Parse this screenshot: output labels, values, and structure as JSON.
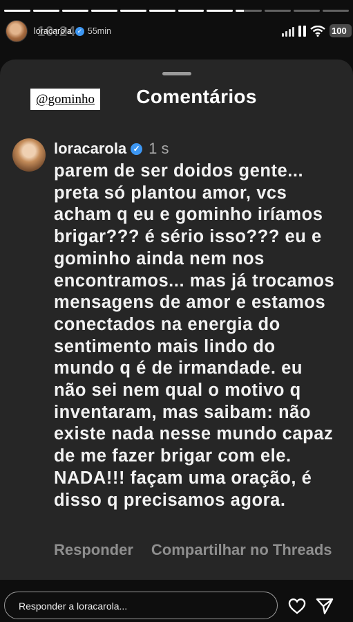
{
  "story": {
    "progress_segments": 12,
    "progress_filled": 8.3,
    "username": "loracarola",
    "time_ago": "55min",
    "status_clock": "10:24",
    "battery": "100"
  },
  "sheet": {
    "mention_tag": "@gominho",
    "title": "Comentários"
  },
  "comment": {
    "username": "loracarola",
    "time": "1 s",
    "text": "parem de ser doidos gente... preta só plantou amor, vcs acham q eu e gominho iríamos brigar??? é sério isso??? eu e gominho ainda nem nos encontramos... mas já trocamos mensagens de amor e estamos conectados na energia do sentimento mais lindo do mundo q é de irmandade. eu não sei nem qual o motivo q inventaram, mas saibam: não existe nada nesse mundo capaz de me fazer brigar com ele. NADA!!! façam uma oração, é disso q precisamos agora.",
    "reply_label": "Responder",
    "share_label": "Compartilhar no Threads"
  },
  "footer": {
    "reply_placeholder": "Responder a loracarola..."
  },
  "colors": {
    "sheet_bg": "#262626",
    "verified_blue": "#3d97f3",
    "muted_text": "#8e8e8e"
  },
  "icons": {
    "like": "heart-icon",
    "send": "send-icon",
    "verified": "verified-badge-icon"
  }
}
